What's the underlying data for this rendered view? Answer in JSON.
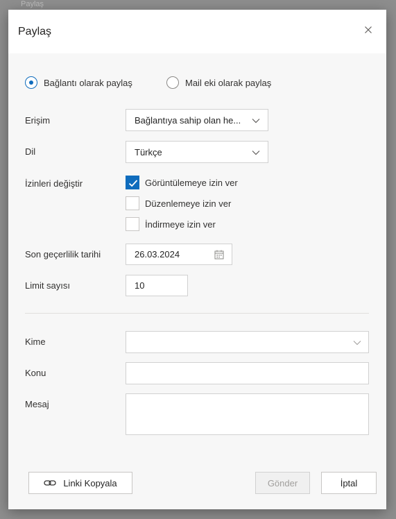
{
  "backdrop": {
    "text": "Paylaş"
  },
  "dialog": {
    "title": "Paylaş",
    "close_icon": "close-icon"
  },
  "share_mode": {
    "options": [
      {
        "label": "Bağlantı olarak paylaş",
        "selected": true
      },
      {
        "label": "Mail eki olarak paylaş",
        "selected": false
      }
    ]
  },
  "form": {
    "access": {
      "label": "Erişim",
      "value": "Bağlantıya sahip olan he..."
    },
    "language": {
      "label": "Dil",
      "value": "Türkçe"
    },
    "permissions": {
      "label": "İzinleri değiştir",
      "items": [
        {
          "label": "Görüntülemeye izin ver",
          "checked": true
        },
        {
          "label": "Düzenlemeye izin ver",
          "checked": false
        },
        {
          "label": "İndirmeye izin ver",
          "checked": false
        }
      ]
    },
    "expiry": {
      "label": "Son geçerlilik tarihi",
      "value": "26.03.2024",
      "icon": "calendar-icon"
    },
    "limit": {
      "label": "Limit sayısı",
      "value": "10"
    },
    "to": {
      "label": "Kime",
      "value": ""
    },
    "subject": {
      "label": "Konu",
      "value": ""
    },
    "message": {
      "label": "Mesaj",
      "value": ""
    }
  },
  "footer": {
    "copy_link": {
      "label": "Linki Kopyala",
      "icon": "link-icon"
    },
    "send": {
      "label": "Gönder",
      "disabled": true
    },
    "cancel": {
      "label": "İptal"
    }
  },
  "colors": {
    "accent": "#0f6cbd",
    "dialog_bg": "#f7f7f7",
    "header_bg": "#ffffff",
    "backdrop": "#8e8e8e"
  }
}
